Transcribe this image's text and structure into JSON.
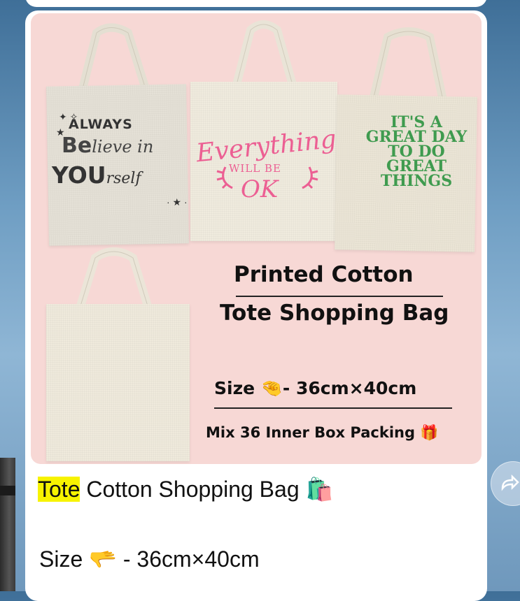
{
  "media": {
    "bag1_line1": "ALWAYS",
    "bag1_line2a": "Be",
    "bag1_line2b": "lieve in",
    "bag1_line3a": "YOU",
    "bag1_line3b": "rself",
    "bag2_line1": "Everything",
    "bag2_line2": "WILL BE",
    "bag2_line3": "OK",
    "bag3_text": "IT'S A GREAT DAY TO DO GREAT THINGS",
    "title_line1": "Printed Cotton",
    "title_line2": "Tote Shopping Bag",
    "size_text": "Size 🤏- 36cm×40cm",
    "packing_text": "Mix 36 Inner Box Packing 🎁"
  },
  "caption": {
    "highlight": "Tote",
    "rest": " Cotton Shopping Bag 🛍️",
    "size_line": "Size 🫳 - 36cm×40cm"
  },
  "colors": {
    "media_bg": "#f7d8d5",
    "pink_print": "#ec5f93",
    "green_print": "#3f9b4f",
    "highlight": "#f7f300"
  }
}
